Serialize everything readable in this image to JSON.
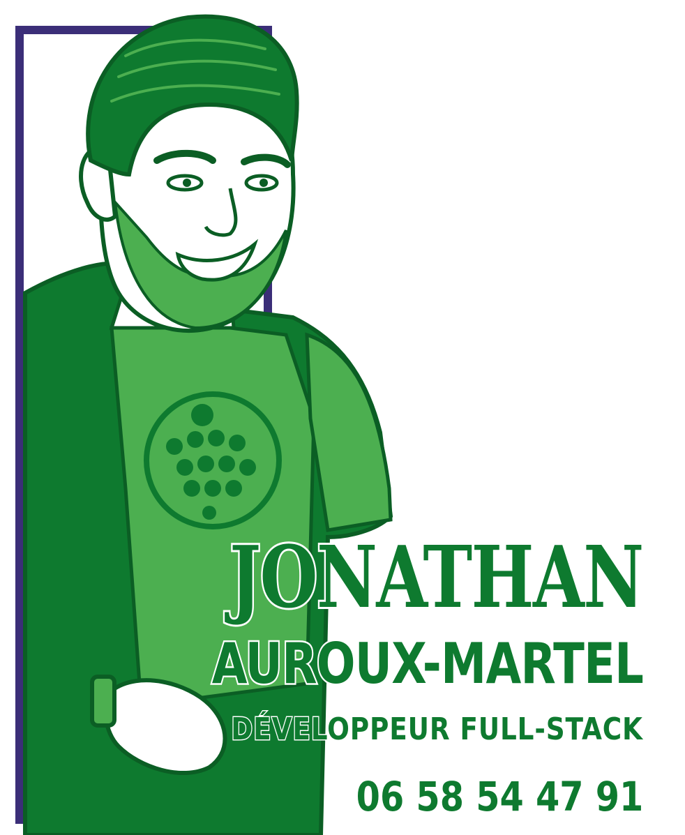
{
  "card": {
    "first_name": "JONATHAN",
    "last_name": "AUROUX-MARTEL",
    "role": "DÉVELOPPEUR FULL-STACK",
    "phone": "06 58 54 47 91"
  },
  "colors": {
    "green_dark": "#0e7a2f",
    "green_light": "#4caf50",
    "frame_purple": "#3b2e78",
    "background": "#ffffff"
  },
  "illustration": "portrait-illustration"
}
